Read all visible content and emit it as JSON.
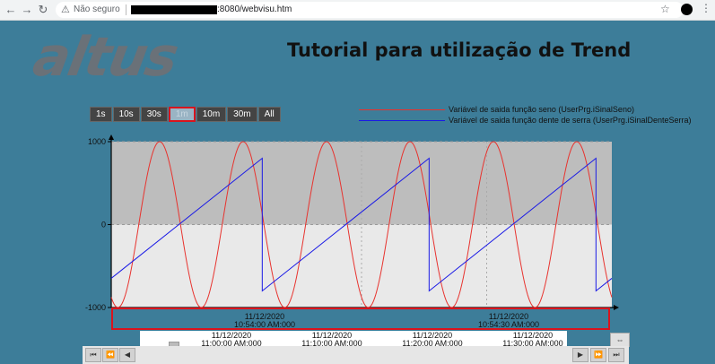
{
  "browser": {
    "back": "←",
    "forward": "→",
    "reload": "↻",
    "security_label": "Não seguro",
    "url_suffix": ":8080/webvisu.htm",
    "star": "☆",
    "menu": "⋮"
  },
  "page": {
    "logo": "altus",
    "title": "Tutorial para utilização de Trend"
  },
  "range_buttons": [
    {
      "label": "1s"
    },
    {
      "label": "10s"
    },
    {
      "label": "30s"
    },
    {
      "label": "1m",
      "active": true
    },
    {
      "label": "10m"
    },
    {
      "label": "30m"
    },
    {
      "label": "All"
    }
  ],
  "legend": [
    {
      "label": "Variável de saida função seno (UserPrg.iSinalSeno)",
      "color": "#e8332e"
    },
    {
      "label": "Variável de saida função dente de serra (UserPrg.iSinalDenteSerra)",
      "color": "#1a1ae6"
    }
  ],
  "chart_data": {
    "type": "line",
    "ylim": [
      -1000,
      1000
    ],
    "yticks": [
      "1000",
      "0",
      "-1000"
    ],
    "x_range": [
      0,
      60
    ],
    "series": [
      {
        "name": "Variável de saida função seno (UserPrg.iSinalSeno)",
        "color": "#e8332e",
        "kind": "sine",
        "amplitude": 1000,
        "period": 10,
        "phase": 6.7
      },
      {
        "name": "Variável de saida função dente de serra (UserPrg.iSinalDenteSerra)",
        "color": "#1a1ae6",
        "kind": "sawtooth",
        "min": -800,
        "max": 800,
        "period": 20,
        "phase": 1.9
      }
    ]
  },
  "time_axis": [
    {
      "date": "11/12/2020",
      "time": "10:54:00 AM:000"
    },
    {
      "date": "11/12/2020",
      "time": "10:54:30 AM:000"
    }
  ],
  "overview_axis": [
    {
      "date": "11/12/2020",
      "time": "11:00:00 AM:000"
    },
    {
      "date": "11/12/2020",
      "time": "11:10:00 AM:000"
    },
    {
      "date": "11/12/2020",
      "time": "11:20:00 AM:000"
    },
    {
      "date": "11/12/2020",
      "time": "11:30:00 AM:000"
    }
  ],
  "nav": {
    "first": "⏮",
    "prev_page": "⏪",
    "prev": "◀",
    "next": "▶",
    "next_page": "⏩",
    "last": "⏭",
    "zoom": "⇔"
  }
}
